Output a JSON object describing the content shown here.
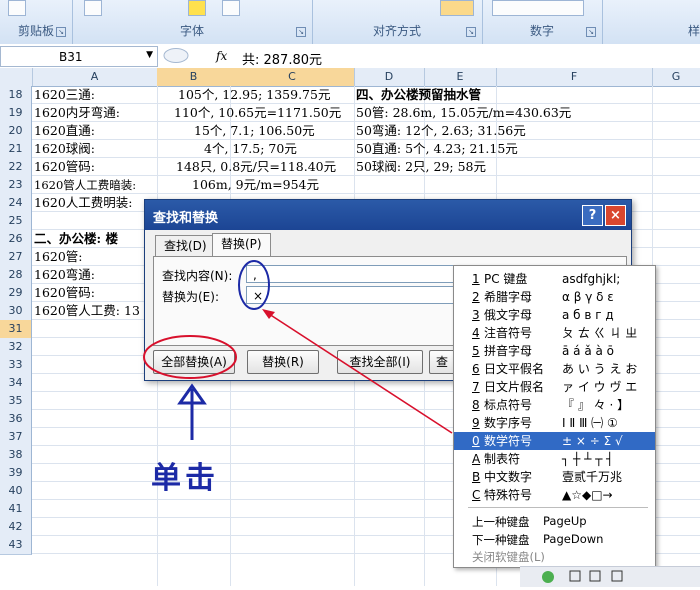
{
  "ribbon": {
    "groups": [
      "剪贴板",
      "字体",
      "对齐方式",
      "数字",
      "样"
    ]
  },
  "formula_bar": {
    "name_box": "B31",
    "fx": "fx",
    "content": "共: 287.80元"
  },
  "columns": [
    "A",
    "B",
    "C",
    "D",
    "E",
    "F",
    "G"
  ],
  "rows": [
    "18",
    "19",
    "20",
    "21",
    "22",
    "23",
    "24",
    "25",
    "26",
    "27",
    "28",
    "29",
    "30",
    "31",
    "32",
    "33",
    "34",
    "35",
    "36",
    "37",
    "38",
    "39",
    "40",
    "41",
    "42",
    "43"
  ],
  "cells": {
    "r18a": "1620三通:",
    "r18b": "105个, 12.95; 1359.75元",
    "r18d": "四、办公楼预留抽水管",
    "r19a": "1620内牙弯通:",
    "r19b": "110个, 10.65元=1171.50元",
    "r19d": "50管: 28.6m, 15.05元/m=430.63元",
    "r20a": "1620直通:",
    "r20b": "15个, 7.1; 106.50元",
    "r20d": "50弯通: 12个, 2.63; 31.56元",
    "r21a": "1620球阀:",
    "r21b": "4个, 17.5; 70元",
    "r21d": "50直通: 5个, 4.23; 21.15元",
    "r22a": "1620管码:",
    "r22b": "148只, 0.8元/只=118.40元",
    "r22d": "50球阀: 2只, 29; 58元",
    "r23a": "1620管人工费暗装:",
    "r23b": "106m, 9元/m=954元",
    "r24a": "1620人工费明装:",
    "r26a": "二、办公楼: 楼",
    "r27a": "1620管:",
    "r28a": "1620弯通:",
    "r29a": "1620管码:",
    "r30a": "1620管人工费: 13"
  },
  "dialog": {
    "title": "查找和替换",
    "help": "?",
    "close": "×",
    "tab_find": "查找(D)",
    "tab_replace": "替换(P)",
    "find_label": "查找内容(N):",
    "find_value": ",",
    "replace_label": "替换为(E):",
    "replace_value": "×",
    "btn_replace_all": "全部替换(A)",
    "btn_replace": "替换(R)",
    "btn_find_all": "查找全部(I)",
    "btn_find_next": "查"
  },
  "soft_keyboard": {
    "items": [
      {
        "key": "1",
        "name": "PC 键盘",
        "sample": "asdfghjkl;"
      },
      {
        "key": "2",
        "name": "希腊字母",
        "sample": "α β γ δ ε"
      },
      {
        "key": "3",
        "name": "俄文字母",
        "sample": "а б в г д"
      },
      {
        "key": "4",
        "name": "注音符号",
        "sample": "ㄆ ㄊ ㄍ ㄐ ㄓ"
      },
      {
        "key": "5",
        "name": "拼音字母",
        "sample": "ā á ǎ à ō"
      },
      {
        "key": "6",
        "name": "日文平假名",
        "sample": "あ い う え お"
      },
      {
        "key": "7",
        "name": "日文片假名",
        "sample": "ァ イ ウ ヴ エ"
      },
      {
        "key": "8",
        "name": "标点符号",
        "sample": "『 』 々 · 】"
      },
      {
        "key": "9",
        "name": "数字序号",
        "sample": "Ⅰ Ⅱ Ⅲ ㈠ ①"
      },
      {
        "key": "0",
        "name": "数学符号",
        "sample": "± × ÷ Σ √"
      },
      {
        "key": "A",
        "name": "制表符",
        "sample": "┐ ┼ ┴ ┬ ┤"
      },
      {
        "key": "B",
        "name": "中文数字",
        "sample": "壹贰千万兆"
      },
      {
        "key": "C",
        "name": "特殊符号",
        "sample": "▲☆◆□→"
      }
    ],
    "highlighted_index": 9,
    "prev": "上一种键盘",
    "prev_key": "PageUp",
    "next": "下一种键盘",
    "next_key": "PageDown",
    "close": "关闭软键盘(L)"
  },
  "annotation": {
    "click_text": "单击",
    "circle_color": "#d8102c",
    "ellipse_color": "#1c2aa6"
  },
  "colors": {
    "selected_header": "#f8d79a",
    "dialog_title": "#2b5aa8",
    "menu_highlight": "#316ac5"
  }
}
